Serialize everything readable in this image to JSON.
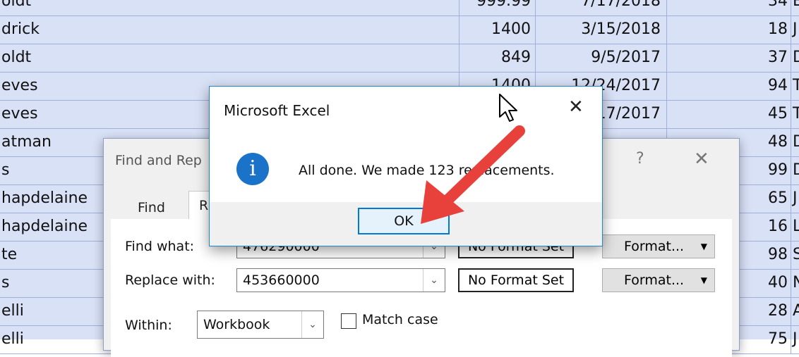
{
  "sheet": {
    "rows": [
      {
        "name": "oldt",
        "amount": "999.99",
        "date": "7/17/2018",
        "num": "34",
        "ch": "E"
      },
      {
        "name": "drick",
        "amount": "1400",
        "date": "3/15/2018",
        "num": "18",
        "ch": "J"
      },
      {
        "name": "oldt",
        "amount": "849",
        "date": "9/5/2017",
        "num": "37",
        "ch": "D"
      },
      {
        "name": "eves",
        "amount": "1400",
        "date": "12/24/2017",
        "num": "94",
        "ch": "T"
      },
      {
        "name": "eves",
        "amount": "",
        "date": "17/2017",
        "num": "45",
        "ch": "T"
      },
      {
        "name": "atman",
        "amount": "",
        "date": "",
        "num": "48",
        "ch": "D"
      },
      {
        "name": "s",
        "amount": "",
        "date": "",
        "num": "99",
        "ch": "D"
      },
      {
        "name": "hapdelaine",
        "amount": "",
        "date": "",
        "num": "65",
        "ch": "J"
      },
      {
        "name": "hapdelaine",
        "amount": "",
        "date": "",
        "num": "16",
        "ch": "L"
      },
      {
        "name": "te",
        "amount": "",
        "date": "",
        "num": "98",
        "ch": "S"
      },
      {
        "name": "s",
        "amount": "",
        "date": "",
        "num": "40",
        "ch": "N"
      },
      {
        "name": "elli",
        "amount": "",
        "date": "",
        "num": "28",
        "ch": "A"
      },
      {
        "name": "elli",
        "amount": "",
        "date": "",
        "num": "75",
        "ch": "J"
      }
    ]
  },
  "find_replace": {
    "title": "Find and Rep",
    "help": "?",
    "close": "✕",
    "tabs": {
      "find": "Find",
      "replace": "R"
    },
    "find_what_label": "Find what:",
    "find_what_value": "476290000",
    "replace_with_label": "Replace with:",
    "replace_with_value": "453660000",
    "no_format_1": "No Format Set",
    "no_format_2": "No Format Set",
    "format_btn": "Format...",
    "within_label": "Within:",
    "within_value": "Workbook",
    "match_case": "Match case"
  },
  "message_box": {
    "title": "Microsoft Excel",
    "close": "✕",
    "message": "All done. We made 123 replacements.",
    "ok": "OK",
    "icon": "info-icon"
  },
  "colors": {
    "selection": "#d9e1f7",
    "arrow": "#e8413c",
    "accent": "#0078d7"
  }
}
